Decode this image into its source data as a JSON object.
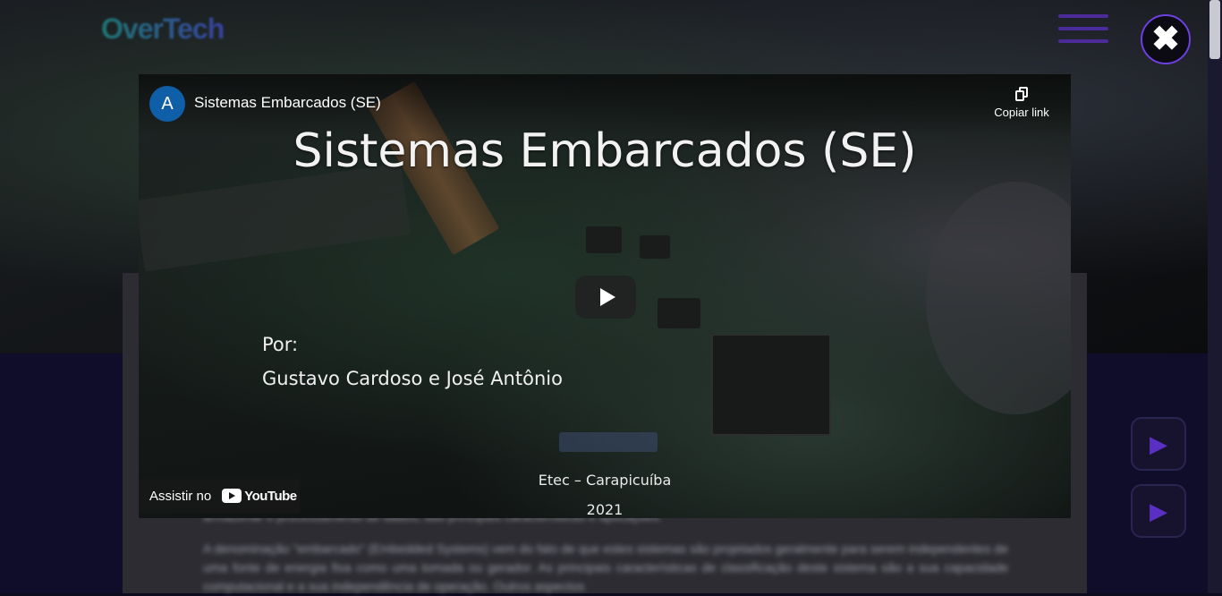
{
  "site": {
    "logo_text": "OverTech",
    "background_paragraph_1": "armazenar o processamento de dados, das principais características e aplicações.",
    "background_paragraph_2": "A denominação \"embarcado\" (Embedded Systems) vem do fato de que estes sistemas são projetados geralmente para serem independentes de uma fonte de energia fixa como uma tomada ou gerador. As principais características de classificação deste sistema são a sua capacidade computacional e a sua independência de operação. Outros aspectos"
  },
  "modal": {
    "close_icon": "close-icon"
  },
  "video": {
    "channel_initial": "A",
    "title": "Sistemas Embarcados (SE)",
    "copy_link_label": "Copiar link",
    "watch_on_label": "Assistir no",
    "youtube_wordmark": "YouTube"
  },
  "slide": {
    "title": "Sistemas Embarcados (SE)",
    "by_label": "Por:",
    "authors": "Gustavo Cardoso e José Antônio",
    "school": "Etec – Carapicuíba",
    "year": "2021"
  },
  "colors": {
    "accent": "#6d3fe0",
    "avatar": "#0f5fa8"
  }
}
